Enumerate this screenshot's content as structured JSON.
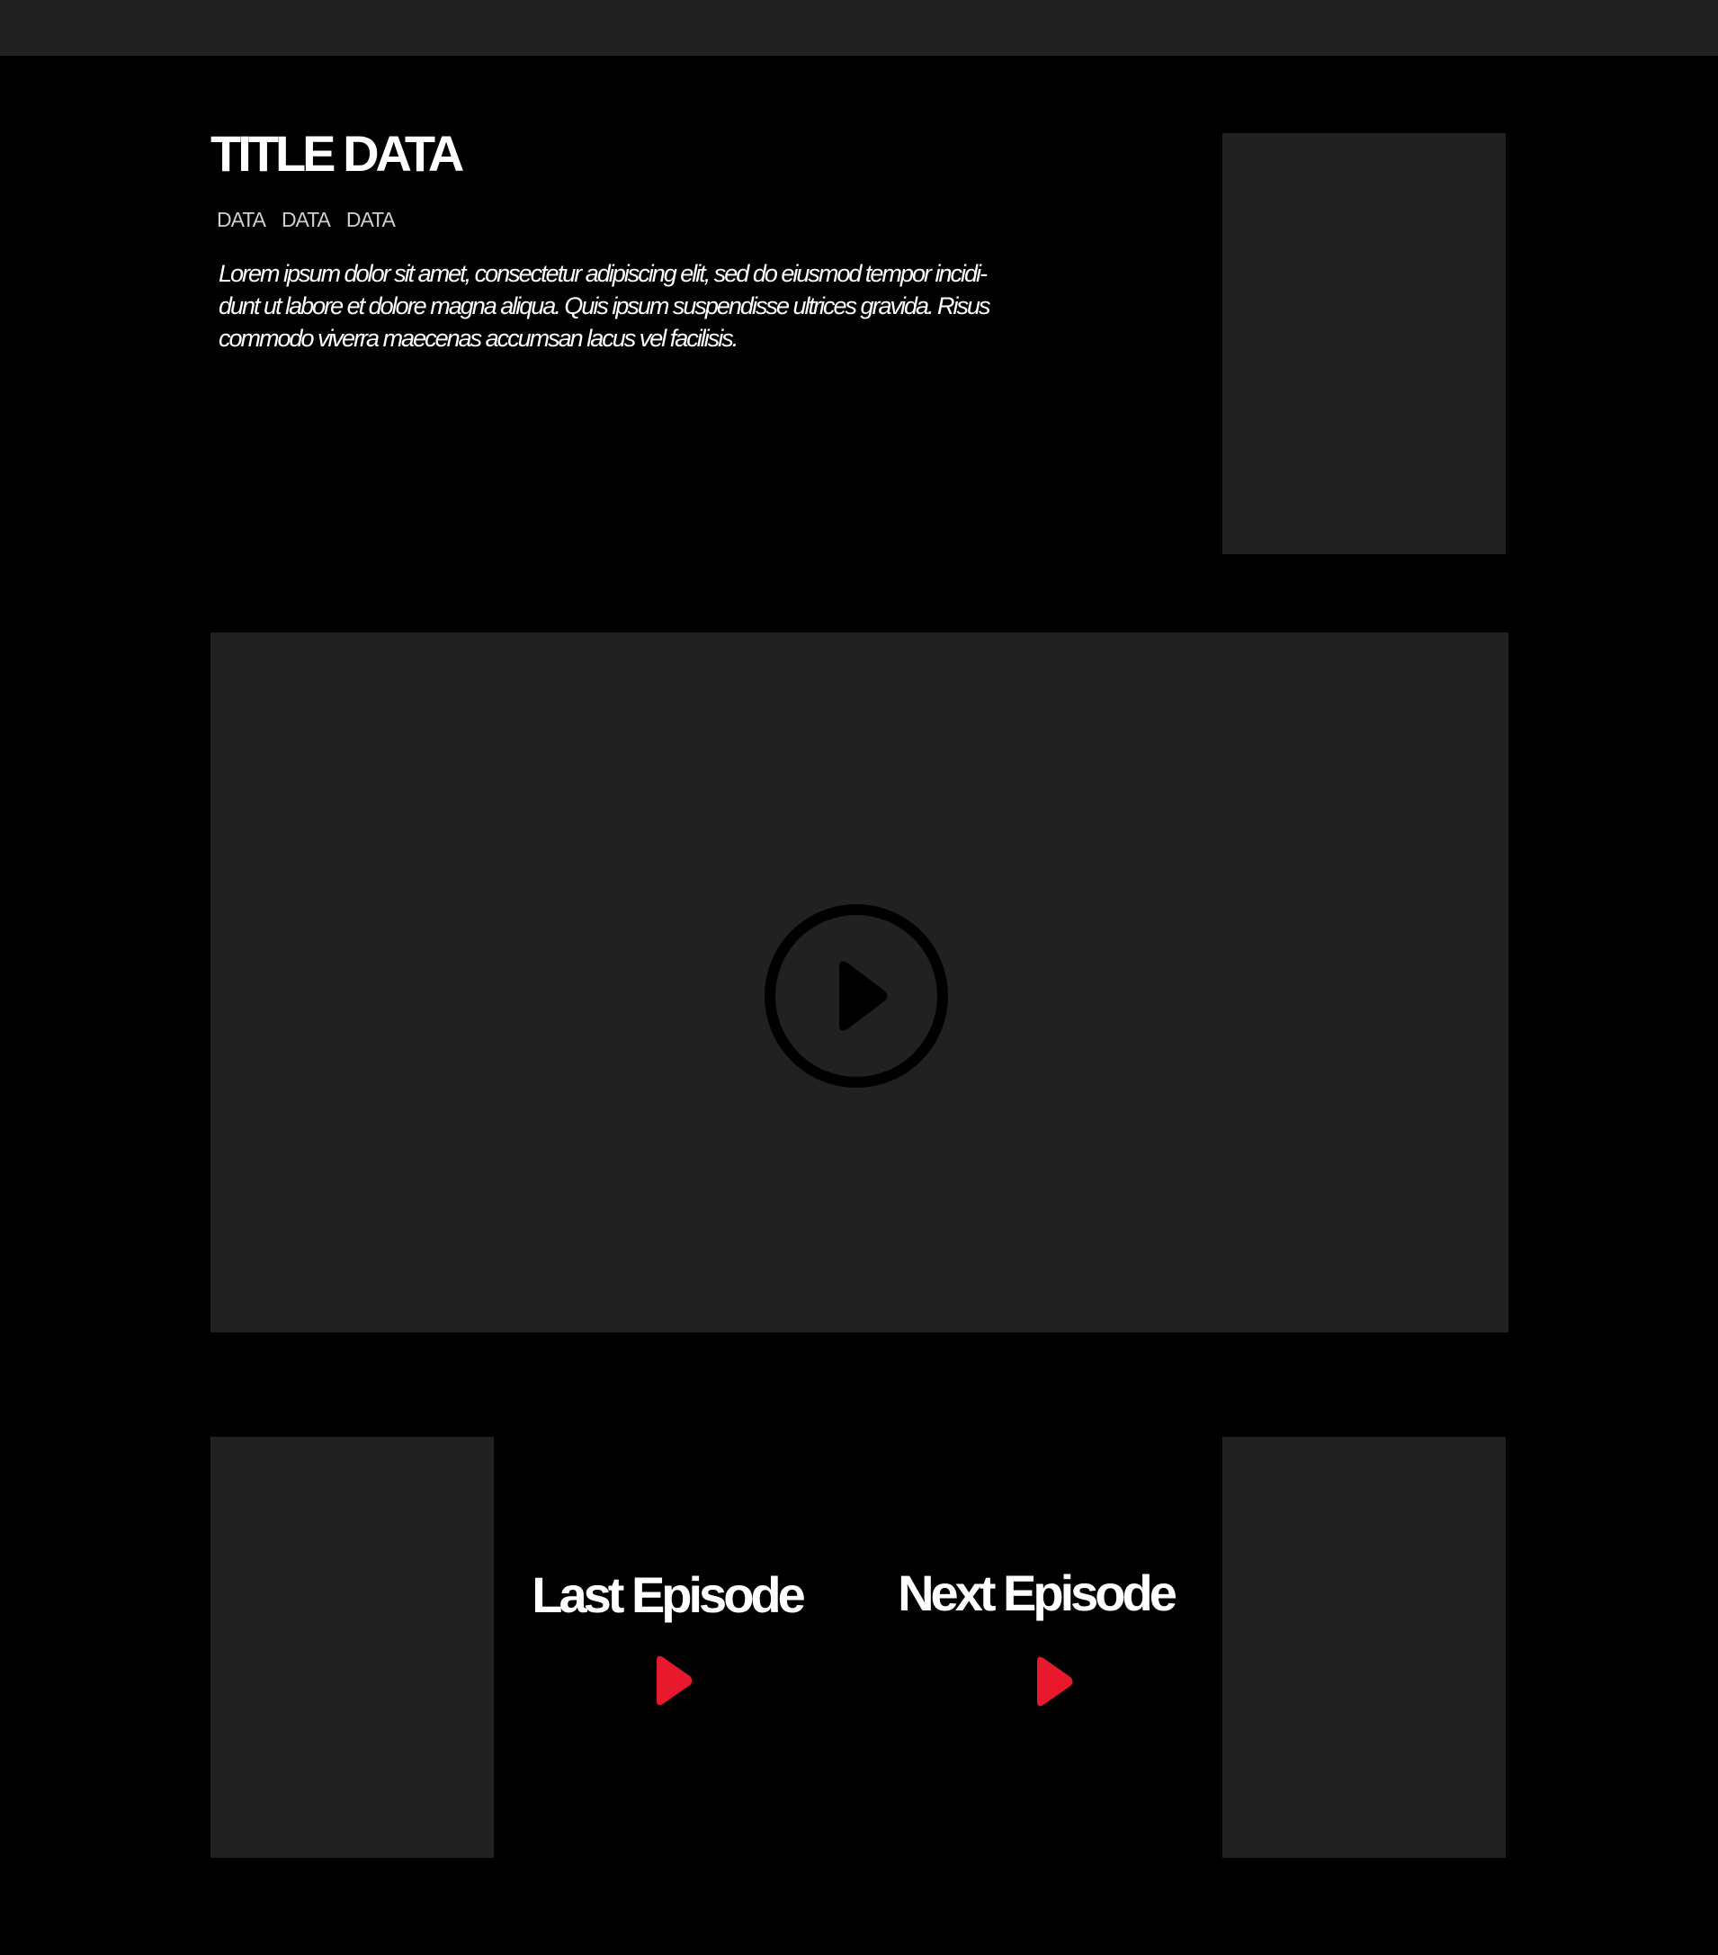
{
  "header": {
    "title": "TITLE DATA",
    "meta": [
      "DATA",
      "DATA",
      "DATA"
    ],
    "description": "Lorem ipsum dolor sit amet, consectetur adipiscing elit, sed do eiusmod tempor incidi-dunt ut labore et dolore magna aliqua. Quis ipsum suspendisse ultrices gravida. Risus commodo viverra maecenas accumsan lacus vel facilisis."
  },
  "player": {
    "play_icon": "play-circle-icon"
  },
  "episodes": {
    "last_label": "Last Episode",
    "next_label": "Next Episode",
    "arrow_icon": "play-arrow-icon"
  },
  "colors": {
    "background": "#000000",
    "panel": "#212121",
    "text": "#ffffff",
    "accent": "#e8192c"
  }
}
